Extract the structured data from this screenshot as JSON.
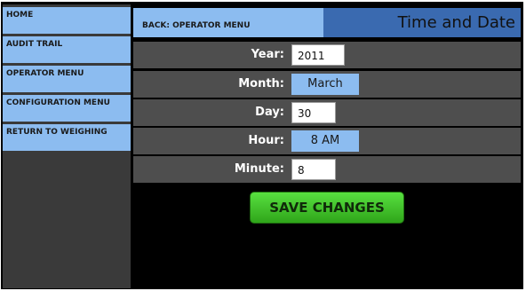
{
  "sidebar": {
    "items": [
      {
        "label": "HOME"
      },
      {
        "label": "AUDIT TRAIL"
      },
      {
        "label": "OPERATOR MENU"
      },
      {
        "label": "CONFIGURATION MENU"
      },
      {
        "label": "RETURN TO WEIGHING"
      }
    ]
  },
  "header": {
    "back_label": "BACK: OPERATOR MENU",
    "title": "Time and Date"
  },
  "form": {
    "year": {
      "label": "Year:",
      "value": "2011"
    },
    "month": {
      "label": "Month:",
      "value": "March"
    },
    "day": {
      "label": "Day:",
      "value": "30"
    },
    "hour": {
      "label": "Hour:",
      "value": "8 AM"
    },
    "minute": {
      "label": "Minute:",
      "value": "8"
    }
  },
  "actions": {
    "save_label": "SAVE CHANGES"
  },
  "colors": {
    "nav_blue": "#8cbcf0",
    "title_blue": "#3a6ab0",
    "save_green": "#3cc024",
    "row_gray": "#4e4e4e"
  }
}
